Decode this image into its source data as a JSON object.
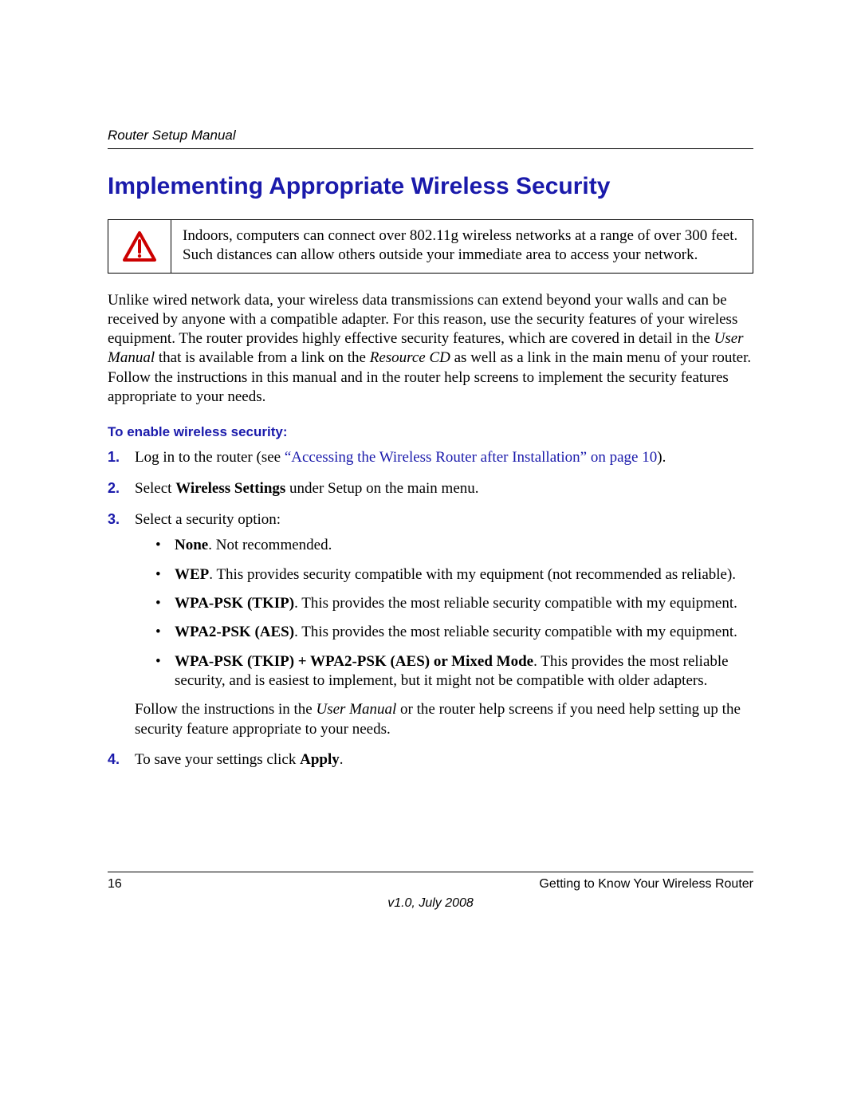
{
  "header": {
    "running_title": "Router Setup Manual"
  },
  "heading": "Implementing Appropriate Wireless Security",
  "warning": {
    "text": "Indoors, computers can connect over 802.11g wireless networks at a range of over 300 feet. Such distances can allow others outside your immediate area to access your network."
  },
  "intro": {
    "p1a": "Unlike wired network data, your wireless data transmissions can extend beyond your walls and can be received by anyone with a compatible adapter. For this reason, use the security features of your wireless equipment. The router provides highly effective security features, which are covered in detail in the ",
    "p1b_italic": "User Manual",
    "p1c": " that is available from a link on the ",
    "p1d_italic": "Resource CD",
    "p1e": " as well as a link in the main menu of your router. Follow the instructions in this manual and in the router help screens to implement the security features appropriate to your needs."
  },
  "subheading": "To enable wireless security:",
  "steps": {
    "s1": {
      "pre": "Log in to the router (see ",
      "link": "“Accessing the Wireless Router after Installation” on page 10",
      "post": ")."
    },
    "s2": {
      "a": "Select ",
      "bold": "Wireless Settings",
      "b": " under Setup on the main menu."
    },
    "s3": {
      "intro": "Select a security option:",
      "opt_none": {
        "bold": "None",
        "rest": ". Not recommended."
      },
      "opt_wep": {
        "bold": "WEP",
        "rest": ". This provides security compatible with my equipment (not recommended as reliable)."
      },
      "opt_wpa": {
        "bold": "WPA-PSK (TKIP)",
        "rest": ". This provides the most reliable security compatible with my equipment."
      },
      "opt_wpa2": {
        "bold": "WPA2-PSK (AES)",
        "rest": ". This provides the most reliable security compatible with my equipment."
      },
      "opt_mixed": {
        "bold": "WPA-PSK (TKIP) + WPA2-PSK (AES) or Mixed Mode",
        "rest": ".  This provides the most reliable security, and is easiest to implement, but it might not be compatible with older adapters."
      },
      "follow_a": "Follow the instructions in the ",
      "follow_b_italic": "User Manual",
      "follow_c": " or the router help screens if you need help setting up the security feature appropriate to your needs."
    },
    "s4": {
      "a": "To save your settings click ",
      "bold": "Apply",
      "b": "."
    }
  },
  "footer": {
    "page_number": "16",
    "section": "Getting to Know Your Wireless Router",
    "version": "v1.0, July 2008"
  }
}
